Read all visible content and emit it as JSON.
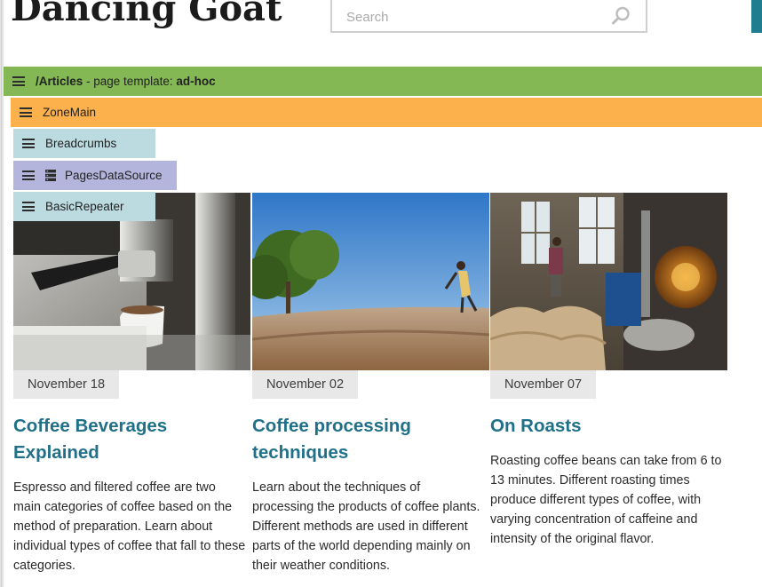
{
  "site": {
    "logo": "Dancing Goat"
  },
  "search": {
    "placeholder": "Search"
  },
  "widgets": {
    "page_bar": {
      "path": "/Articles",
      "separator": " - page template: ",
      "template": "ad-hoc"
    },
    "zone": "ZoneMain",
    "breadcrumbs": "Breadcrumbs",
    "datasource": "PagesDataSource",
    "repeater": "BasicRepeater"
  },
  "articles": [
    {
      "date": "November 18",
      "title": "Coffee Beverages Explained",
      "summary": "Espresso and filtered coffee are two main categories of coffee based on the method of preparation. Learn about individual types of coffee that fall to these categories."
    },
    {
      "date": "November 02",
      "title": "Coffee processing techniques",
      "summary": "Learn about the techniques of processing the products of coffee plants. Different methods are used in different parts of the world depending mainly on their weather conditions."
    },
    {
      "date": "November 07",
      "title": "On Roasts",
      "summary": "Roasting coffee beans can take from 6 to 13 minutes. Different roasting times produce different types of coffee, with varying concentration of caffeine and intensity of the original flavor."
    }
  ],
  "colors": {
    "accent_teal": "#207089",
    "page_bar": "#84b854",
    "zone_bar": "#fdb14d",
    "webpart_bar": "#bcdbe0",
    "datasource_bar": "#b3b5dc"
  }
}
